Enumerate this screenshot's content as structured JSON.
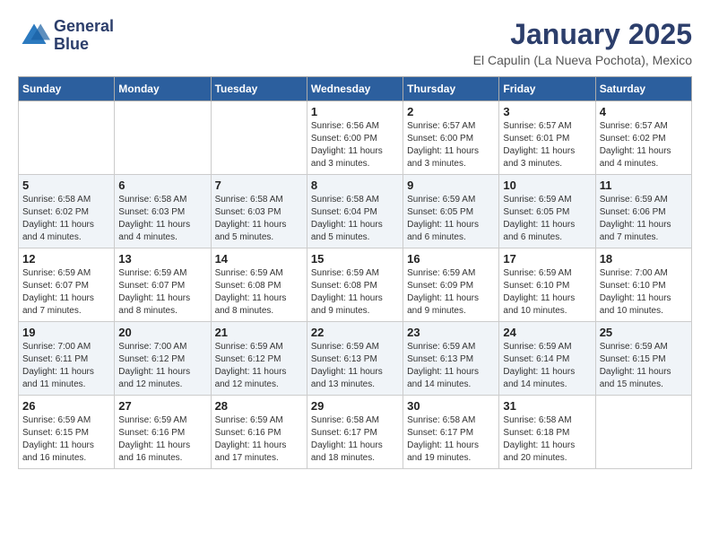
{
  "header": {
    "logo_line1": "General",
    "logo_line2": "Blue",
    "month": "January 2025",
    "location": "El Capulin (La Nueva Pochota), Mexico"
  },
  "weekdays": [
    "Sunday",
    "Monday",
    "Tuesday",
    "Wednesday",
    "Thursday",
    "Friday",
    "Saturday"
  ],
  "weeks": [
    [
      {
        "day": "",
        "info": ""
      },
      {
        "day": "",
        "info": ""
      },
      {
        "day": "",
        "info": ""
      },
      {
        "day": "1",
        "info": "Sunrise: 6:56 AM\nSunset: 6:00 PM\nDaylight: 11 hours\nand 3 minutes."
      },
      {
        "day": "2",
        "info": "Sunrise: 6:57 AM\nSunset: 6:00 PM\nDaylight: 11 hours\nand 3 minutes."
      },
      {
        "day": "3",
        "info": "Sunrise: 6:57 AM\nSunset: 6:01 PM\nDaylight: 11 hours\nand 3 minutes."
      },
      {
        "day": "4",
        "info": "Sunrise: 6:57 AM\nSunset: 6:02 PM\nDaylight: 11 hours\nand 4 minutes."
      }
    ],
    [
      {
        "day": "5",
        "info": "Sunrise: 6:58 AM\nSunset: 6:02 PM\nDaylight: 11 hours\nand 4 minutes."
      },
      {
        "day": "6",
        "info": "Sunrise: 6:58 AM\nSunset: 6:03 PM\nDaylight: 11 hours\nand 4 minutes."
      },
      {
        "day": "7",
        "info": "Sunrise: 6:58 AM\nSunset: 6:03 PM\nDaylight: 11 hours\nand 5 minutes."
      },
      {
        "day": "8",
        "info": "Sunrise: 6:58 AM\nSunset: 6:04 PM\nDaylight: 11 hours\nand 5 minutes."
      },
      {
        "day": "9",
        "info": "Sunrise: 6:59 AM\nSunset: 6:05 PM\nDaylight: 11 hours\nand 6 minutes."
      },
      {
        "day": "10",
        "info": "Sunrise: 6:59 AM\nSunset: 6:05 PM\nDaylight: 11 hours\nand 6 minutes."
      },
      {
        "day": "11",
        "info": "Sunrise: 6:59 AM\nSunset: 6:06 PM\nDaylight: 11 hours\nand 7 minutes."
      }
    ],
    [
      {
        "day": "12",
        "info": "Sunrise: 6:59 AM\nSunset: 6:07 PM\nDaylight: 11 hours\nand 7 minutes."
      },
      {
        "day": "13",
        "info": "Sunrise: 6:59 AM\nSunset: 6:07 PM\nDaylight: 11 hours\nand 8 minutes."
      },
      {
        "day": "14",
        "info": "Sunrise: 6:59 AM\nSunset: 6:08 PM\nDaylight: 11 hours\nand 8 minutes."
      },
      {
        "day": "15",
        "info": "Sunrise: 6:59 AM\nSunset: 6:08 PM\nDaylight: 11 hours\nand 9 minutes."
      },
      {
        "day": "16",
        "info": "Sunrise: 6:59 AM\nSunset: 6:09 PM\nDaylight: 11 hours\nand 9 minutes."
      },
      {
        "day": "17",
        "info": "Sunrise: 6:59 AM\nSunset: 6:10 PM\nDaylight: 11 hours\nand 10 minutes."
      },
      {
        "day": "18",
        "info": "Sunrise: 7:00 AM\nSunset: 6:10 PM\nDaylight: 11 hours\nand 10 minutes."
      }
    ],
    [
      {
        "day": "19",
        "info": "Sunrise: 7:00 AM\nSunset: 6:11 PM\nDaylight: 11 hours\nand 11 minutes."
      },
      {
        "day": "20",
        "info": "Sunrise: 7:00 AM\nSunset: 6:12 PM\nDaylight: 11 hours\nand 12 minutes."
      },
      {
        "day": "21",
        "info": "Sunrise: 6:59 AM\nSunset: 6:12 PM\nDaylight: 11 hours\nand 12 minutes."
      },
      {
        "day": "22",
        "info": "Sunrise: 6:59 AM\nSunset: 6:13 PM\nDaylight: 11 hours\nand 13 minutes."
      },
      {
        "day": "23",
        "info": "Sunrise: 6:59 AM\nSunset: 6:13 PM\nDaylight: 11 hours\nand 14 minutes."
      },
      {
        "day": "24",
        "info": "Sunrise: 6:59 AM\nSunset: 6:14 PM\nDaylight: 11 hours\nand 14 minutes."
      },
      {
        "day": "25",
        "info": "Sunrise: 6:59 AM\nSunset: 6:15 PM\nDaylight: 11 hours\nand 15 minutes."
      }
    ],
    [
      {
        "day": "26",
        "info": "Sunrise: 6:59 AM\nSunset: 6:15 PM\nDaylight: 11 hours\nand 16 minutes."
      },
      {
        "day": "27",
        "info": "Sunrise: 6:59 AM\nSunset: 6:16 PM\nDaylight: 11 hours\nand 16 minutes."
      },
      {
        "day": "28",
        "info": "Sunrise: 6:59 AM\nSunset: 6:16 PM\nDaylight: 11 hours\nand 17 minutes."
      },
      {
        "day": "29",
        "info": "Sunrise: 6:58 AM\nSunset: 6:17 PM\nDaylight: 11 hours\nand 18 minutes."
      },
      {
        "day": "30",
        "info": "Sunrise: 6:58 AM\nSunset: 6:17 PM\nDaylight: 11 hours\nand 19 minutes."
      },
      {
        "day": "31",
        "info": "Sunrise: 6:58 AM\nSunset: 6:18 PM\nDaylight: 11 hours\nand 20 minutes."
      },
      {
        "day": "",
        "info": ""
      }
    ]
  ]
}
